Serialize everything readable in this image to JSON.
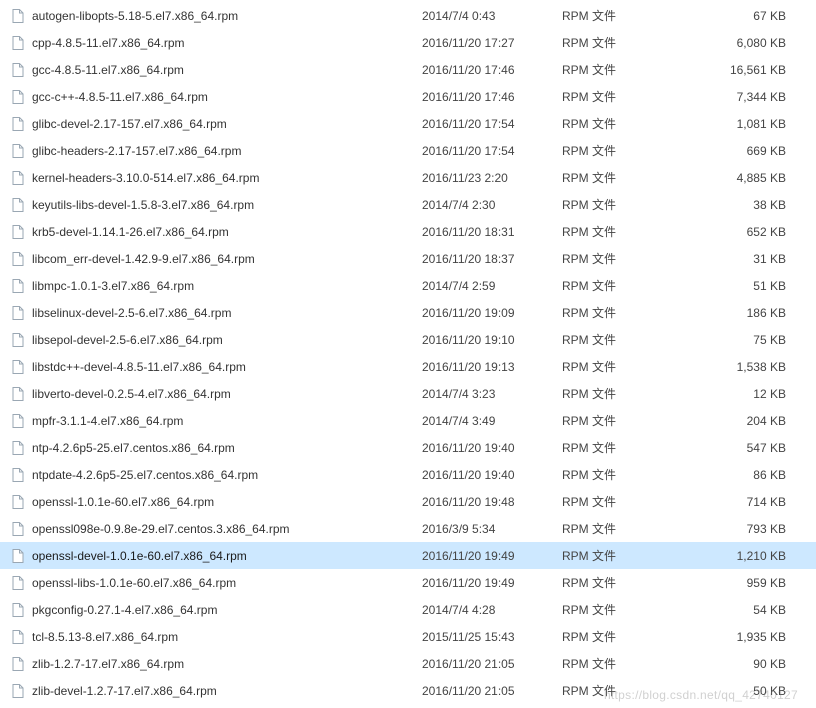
{
  "file_type_label": "RPM 文件",
  "watermark": "https://blog.csdn.net/qq_42740127",
  "selected_index": 20,
  "files": [
    {
      "name": "autogen-libopts-5.18-5.el7.x86_64.rpm",
      "date": "2014/7/4 0:43",
      "size": "67 KB"
    },
    {
      "name": "cpp-4.8.5-11.el7.x86_64.rpm",
      "date": "2016/11/20 17:27",
      "size": "6,080 KB"
    },
    {
      "name": "gcc-4.8.5-11.el7.x86_64.rpm",
      "date": "2016/11/20 17:46",
      "size": "16,561 KB"
    },
    {
      "name": "gcc-c++-4.8.5-11.el7.x86_64.rpm",
      "date": "2016/11/20 17:46",
      "size": "7,344 KB"
    },
    {
      "name": "glibc-devel-2.17-157.el7.x86_64.rpm",
      "date": "2016/11/20 17:54",
      "size": "1,081 KB"
    },
    {
      "name": "glibc-headers-2.17-157.el7.x86_64.rpm",
      "date": "2016/11/20 17:54",
      "size": "669 KB"
    },
    {
      "name": "kernel-headers-3.10.0-514.el7.x86_64.rpm",
      "date": "2016/11/23 2:20",
      "size": "4,885 KB"
    },
    {
      "name": "keyutils-libs-devel-1.5.8-3.el7.x86_64.rpm",
      "date": "2014/7/4 2:30",
      "size": "38 KB"
    },
    {
      "name": "krb5-devel-1.14.1-26.el7.x86_64.rpm",
      "date": "2016/11/20 18:31",
      "size": "652 KB"
    },
    {
      "name": "libcom_err-devel-1.42.9-9.el7.x86_64.rpm",
      "date": "2016/11/20 18:37",
      "size": "31 KB"
    },
    {
      "name": "libmpc-1.0.1-3.el7.x86_64.rpm",
      "date": "2014/7/4 2:59",
      "size": "51 KB"
    },
    {
      "name": "libselinux-devel-2.5-6.el7.x86_64.rpm",
      "date": "2016/11/20 19:09",
      "size": "186 KB"
    },
    {
      "name": "libsepol-devel-2.5-6.el7.x86_64.rpm",
      "date": "2016/11/20 19:10",
      "size": "75 KB"
    },
    {
      "name": "libstdc++-devel-4.8.5-11.el7.x86_64.rpm",
      "date": "2016/11/20 19:13",
      "size": "1,538 KB"
    },
    {
      "name": "libverto-devel-0.2.5-4.el7.x86_64.rpm",
      "date": "2014/7/4 3:23",
      "size": "12 KB"
    },
    {
      "name": "mpfr-3.1.1-4.el7.x86_64.rpm",
      "date": "2014/7/4 3:49",
      "size": "204 KB"
    },
    {
      "name": "ntp-4.2.6p5-25.el7.centos.x86_64.rpm",
      "date": "2016/11/20 19:40",
      "size": "547 KB"
    },
    {
      "name": "ntpdate-4.2.6p5-25.el7.centos.x86_64.rpm",
      "date": "2016/11/20 19:40",
      "size": "86 KB"
    },
    {
      "name": "openssl-1.0.1e-60.el7.x86_64.rpm",
      "date": "2016/11/20 19:48",
      "size": "714 KB"
    },
    {
      "name": "openssl098e-0.9.8e-29.el7.centos.3.x86_64.rpm",
      "date": "2016/3/9 5:34",
      "size": "793 KB"
    },
    {
      "name": "openssl-devel-1.0.1e-60.el7.x86_64.rpm",
      "date": "2016/11/20 19:49",
      "size": "1,210 KB"
    },
    {
      "name": "openssl-libs-1.0.1e-60.el7.x86_64.rpm",
      "date": "2016/11/20 19:49",
      "size": "959 KB"
    },
    {
      "name": "pkgconfig-0.27.1-4.el7.x86_64.rpm",
      "date": "2014/7/4 4:28",
      "size": "54 KB"
    },
    {
      "name": "tcl-8.5.13-8.el7.x86_64.rpm",
      "date": "2015/11/25 15:43",
      "size": "1,935 KB"
    },
    {
      "name": "zlib-1.2.7-17.el7.x86_64.rpm",
      "date": "2016/11/20 21:05",
      "size": "90 KB"
    },
    {
      "name": "zlib-devel-1.2.7-17.el7.x86_64.rpm",
      "date": "2016/11/20 21:05",
      "size": "50 KB"
    }
  ]
}
